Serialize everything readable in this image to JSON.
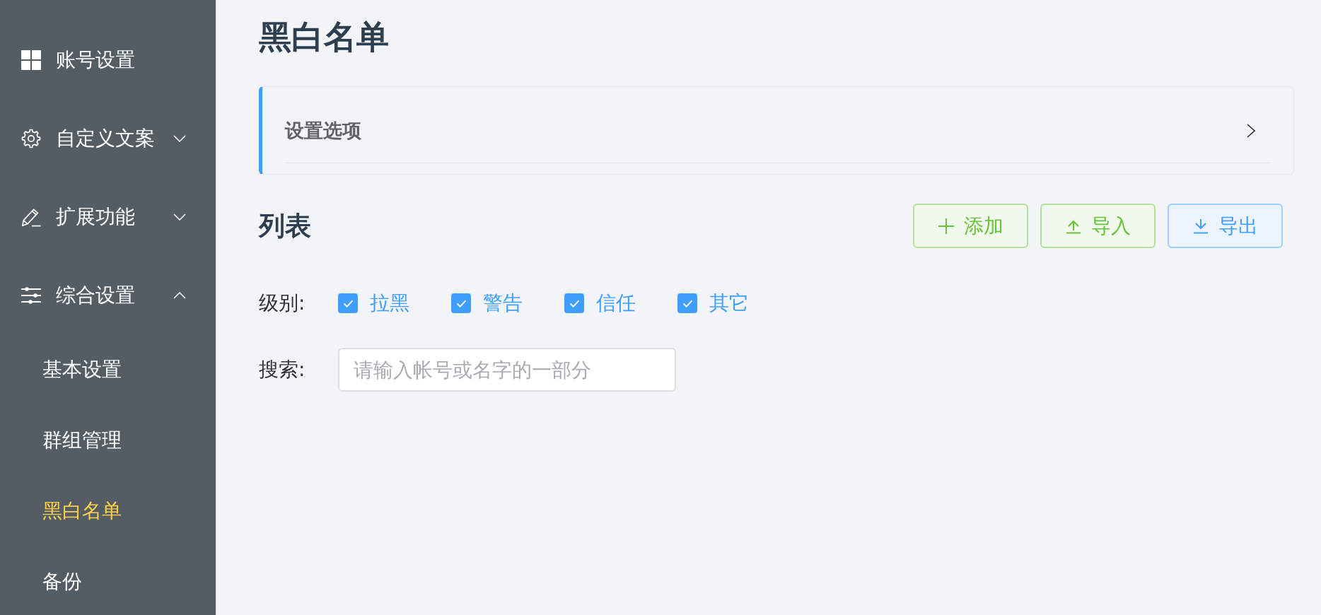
{
  "sidebar": {
    "items": [
      {
        "kind": "item",
        "label": "账号设置",
        "selected": false
      },
      {
        "kind": "submenu",
        "label": "自定义文案",
        "selected": false,
        "expanded": false
      },
      {
        "kind": "submenu",
        "label": "扩展功能",
        "selected": false,
        "expanded": false
      },
      {
        "kind": "submenu",
        "label": "综合设置",
        "selected": false,
        "expanded": true,
        "children": [
          {
            "label": "基本设置",
            "selected": false
          },
          {
            "label": "群组管理",
            "selected": false
          },
          {
            "label": "黑白名单",
            "selected": true
          },
          {
            "label": "备份",
            "selected": false
          }
        ]
      }
    ]
  },
  "page_title": "黑白名单",
  "settings_panel": {
    "title": "设置选项",
    "expanded": false
  },
  "list": {
    "title": "列表",
    "buttons": [
      {
        "kind": "add",
        "label": "添加"
      },
      {
        "kind": "import",
        "label": "导入"
      },
      {
        "kind": "export",
        "label": "导出"
      }
    ]
  },
  "filters": {
    "level": {
      "label": "级别:",
      "options": [
        {
          "label": "拉黑",
          "checked": true
        },
        {
          "label": "警告",
          "checked": true
        },
        {
          "label": "信任",
          "checked": true
        },
        {
          "label": "其它",
          "checked": true
        }
      ]
    },
    "search": {
      "label": "搜索:",
      "placeholder": "请输入帐号或名字的一部分"
    }
  }
}
